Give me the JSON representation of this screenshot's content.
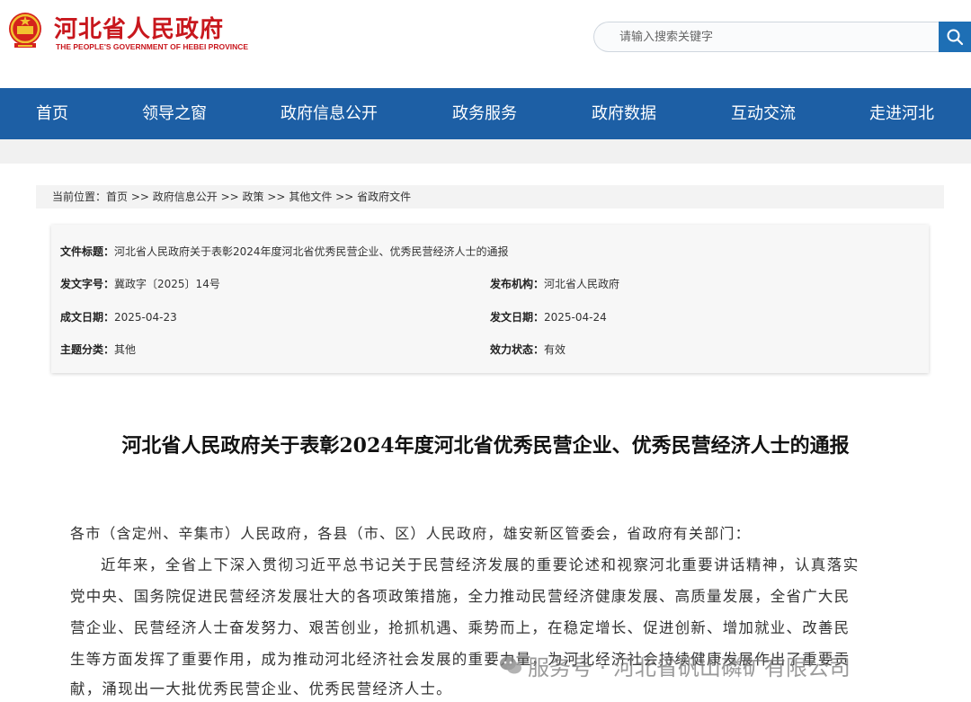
{
  "header": {
    "site_name": "河北省人民政府",
    "site_name_en": "THE PEOPLE'S GOVERNMENT OF HEBEI PROVINCE",
    "brand_color": "#c8171d",
    "search_placeholder": "请输入搜索关键字"
  },
  "nav": {
    "items": [
      "首页",
      "领导之窗",
      "政府信息公开",
      "政务服务",
      "政府数据",
      "互动交流",
      "走进河北"
    ],
    "color": "#1d5fa5"
  },
  "breadcrumb": {
    "label": "当前位置：",
    "items": [
      "首页",
      "政府信息公开",
      "政策",
      "其他文件",
      "省政府文件"
    ],
    "sep": " >> "
  },
  "info": {
    "title_label": "文件标题：",
    "title_value": "河北省人民政府关于表彰2024年度河北省优秀民营企业、优秀民营经济人士的通报",
    "doc_no_label": "发文字号：",
    "doc_no_value": "冀政字〔2025〕14号",
    "issuer_label": "发布机构：",
    "issuer_value": "河北省人民政府",
    "created_label": "成文日期：",
    "created_value": "2025-04-23",
    "published_label": "发文日期：",
    "published_value": "2025-04-24",
    "category_label": "主题分类：",
    "category_value": "其他",
    "status_label": "效力状态：",
    "status_value": "有效"
  },
  "document": {
    "title": "河北省人民政府关于表彰2024年度河北省优秀民营企业、优秀民营经济人士的通报",
    "salutation": "各市（含定州、辛集市）人民政府，各县（市、区）人民政府，雄安新区管委会，省政府有关部门：",
    "lines": [
      "近年来，全省上下深入贯彻习近平总书记关于民营经济发展的重要论述和视察河北重要讲话精神，认真落实",
      "党中央、国务院促进民营经济发展壮大的各项政策措施，全力推动民营经济健康发展、高质量发展，全省广大民",
      "营企业、民营经济人士奋发努力、艰苦创业，抢抓机遇、乘势而上，在稳定增长、促进创新、增加就业、改善民",
      "生等方面发挥了重要作用，成为推动河北经济社会发展的重要力量，为河北经济社会持续健康发展作出了重要贡",
      "献，涌现出一大批优秀民营企业、优秀民营经济人士。"
    ]
  },
  "watermark": {
    "text": "服务号 · 河北省矾山磷矿有限公司"
  }
}
